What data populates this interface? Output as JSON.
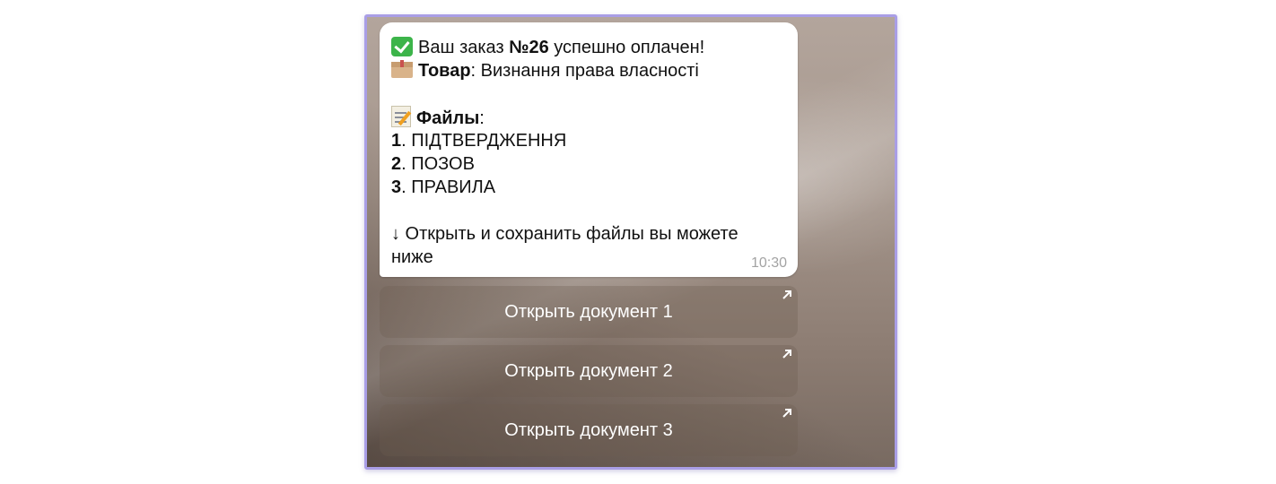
{
  "message": {
    "line1": {
      "icon": "check-mark-emoji",
      "pre": "Ваш заказ ",
      "bold": "№26",
      "post": " успешно оплачен!"
    },
    "line2": {
      "icon": "package-emoji",
      "bold": "Товар",
      "post": ": Визнання права власності"
    },
    "files_header": {
      "icon": "memo-emoji",
      "bold": "Файлы",
      "post": ":"
    },
    "files": [
      {
        "num": "1",
        "name": ". ПІДТВЕРДЖЕННЯ"
      },
      {
        "num": "2",
        "name": ". ПОЗОВ"
      },
      {
        "num": "3",
        "name": ". ПРАВИЛА"
      }
    ],
    "footer_line1": "↓ Открыть и сохранить файлы вы можете",
    "footer_line2": "ниже",
    "time": "10:30"
  },
  "buttons": [
    {
      "label": "Открыть документ 1",
      "icon": "external-link-icon"
    },
    {
      "label": "Открыть документ 2",
      "icon": "external-link-icon"
    },
    {
      "label": "Открыть документ 3",
      "icon": "external-link-icon"
    }
  ],
  "colors": {
    "frame_border": "#a99ee6",
    "bubble": "#ffffff",
    "time": "#a3a3a3"
  }
}
